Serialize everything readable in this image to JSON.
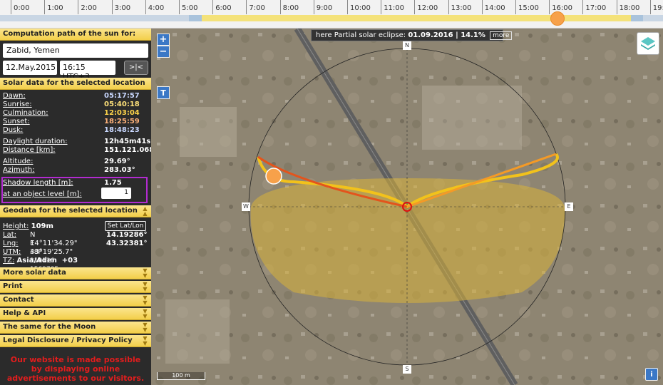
{
  "timeline": {
    "hours": [
      "0:00",
      "1:00",
      "2:00",
      "3:00",
      "4:00",
      "5:00",
      "6:00",
      "7:00",
      "8:00",
      "9:00",
      "10:00",
      "11:00",
      "12:00",
      "13:00",
      "14:00",
      "15:00",
      "16:00",
      "17:00",
      "18:00",
      "19:00"
    ],
    "current_fraction_of_day": 0.6771,
    "daylight_start_hour": 5.68,
    "daylight_end_hour": 18.43,
    "dawn_hour": 5.3,
    "dusk_hour": 18.8
  },
  "sidebar": {
    "heading": "Computation path of the sun for:",
    "location": "Zabid, Yemen",
    "date": "12.May.2015",
    "time": "16:15 UTC+3",
    "now_button": ">|<",
    "solar_heading": "Solar data for the selected location",
    "solar": {
      "dawn_label": "Dawn:",
      "dawn": "05:17:57",
      "sunrise_label": "Sunrise:",
      "sunrise": "05:40:18",
      "culmination_label": "Culmination:",
      "culmination": "12:03:04",
      "sunset_label": "Sunset:",
      "sunset": "18:25:59",
      "dusk_label": "Dusk:",
      "dusk": "18:48:23",
      "daylight_label": "Daylight duration:",
      "daylight": "12h45m41s",
      "distance_label": "Distance [km]:",
      "distance": "151.121.068",
      "altitude_label": "Altitude:",
      "altitude": "29.69°",
      "azimuth_label": "Azimuth:",
      "azimuth": "283.03°",
      "shadow_label": "Shadow length [m]:",
      "shadow": "1.75",
      "object_label": "at an object level [m]:",
      "object_value": "1"
    },
    "geo_heading": "Geodata for the selected location",
    "geo": {
      "height_label": "Height:",
      "height": "109m",
      "set_latlon": "Set Lat/Lon",
      "lat_label": "Lat:",
      "lat_dms": "N 14°11'34.29\"",
      "lat_dec": "14.19286°",
      "lng_label": "Lng:",
      "lng_dms": "E 43°19'25.7\"",
      "lng_dec": "43.32381°",
      "utm_label": "UTM:",
      "utm": "38P 319116 1569705",
      "tz_label": "TZ:",
      "tz": "Asia/Aden  +03"
    },
    "menu": [
      "More solar data",
      "Print",
      "Contact",
      "Help & API",
      "The same for the Moon",
      "Legal Disclosure / Privacy Policy"
    ],
    "ad_text": "Our website is made possible by displaying online advertisements to our visitors."
  },
  "map": {
    "eclipse_prefix": "here Partial solar eclipse:",
    "eclipse_value": "01.09.2016 | 14.1%",
    "more_label": "more",
    "zoom_in": "+",
    "zoom_out": "−",
    "t_button": "T",
    "scale": "100 m",
    "info": "i",
    "compass": {
      "n": "N",
      "s": "S",
      "e": "E",
      "w": "W"
    },
    "colors": {
      "sun_path": "#f2c21b",
      "current_path": "#e3541c",
      "sun_marker": "#f7a14a",
      "day_area": "#d9b23a"
    }
  }
}
